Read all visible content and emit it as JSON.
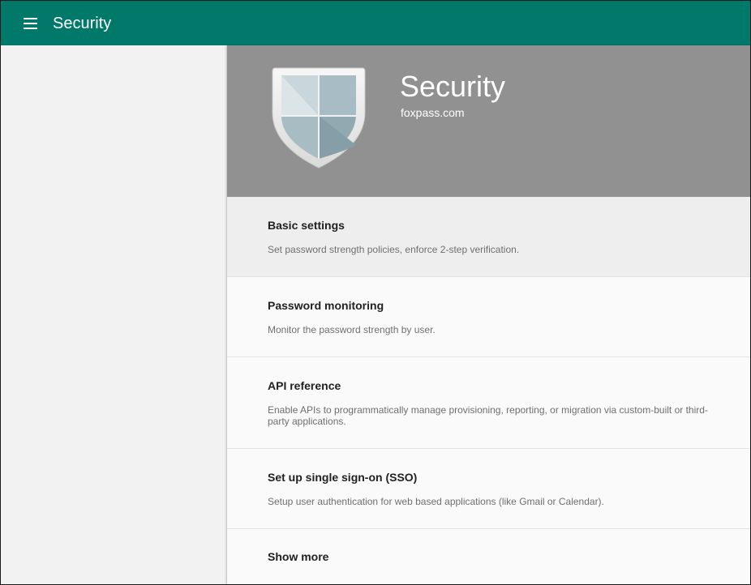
{
  "topbar": {
    "menu_icon": "hamburger-menu-icon",
    "title": "Security",
    "color": "#00796b"
  },
  "hero": {
    "icon": "shield-icon",
    "title": "Security",
    "domain": "foxpass.com",
    "background": "#919191"
  },
  "cards": [
    {
      "title": "Basic settings",
      "description": "Set password strength policies, enforce 2-step verification."
    },
    {
      "title": "Password monitoring",
      "description": "Monitor the password strength by user."
    },
    {
      "title": "API reference",
      "description": "Enable APIs to programmatically manage provisioning, reporting, or migration via custom-built or third-party applications."
    },
    {
      "title": "Set up single sign-on (SSO)",
      "description": "Setup user authentication for web based applications (like Gmail or Calendar)."
    },
    {
      "title": "Show more"
    }
  ]
}
